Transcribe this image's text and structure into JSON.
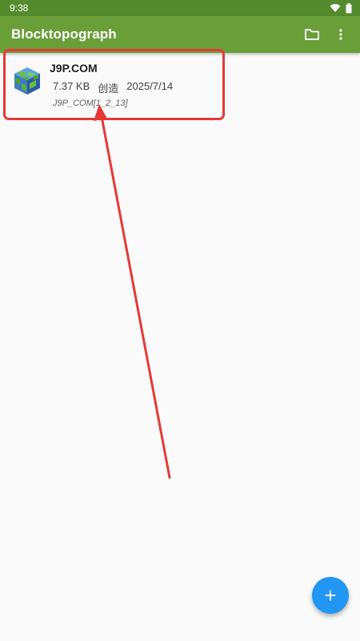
{
  "status_bar": {
    "time": "9:38"
  },
  "app_bar": {
    "title": "Blocktopograph",
    "actions": [
      {
        "icon": "folder-icon"
      },
      {
        "icon": "more-vert-icon"
      }
    ]
  },
  "worlds": [
    {
      "name": "J9P.COM",
      "size": "7.37 KB",
      "mode": "创造",
      "date": "2025/7/14",
      "folder": "J9P_COM[1_2_13]",
      "icon": "world-cube-icon"
    }
  ],
  "fab": {
    "label": "+",
    "icon": "add-icon"
  },
  "colors": {
    "status_bar": "#558b2f",
    "app_bar": "#6a9e38",
    "fab": "#2196f3",
    "annotation": "#e53935"
  }
}
